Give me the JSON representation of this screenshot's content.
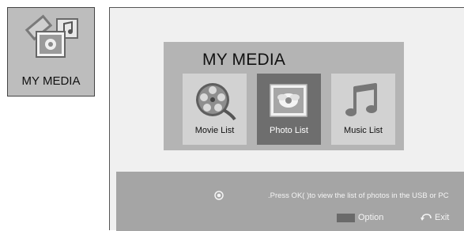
{
  "tile": {
    "label": "MY MEDIA",
    "icon": "my-media-icon"
  },
  "panel": {
    "title": "MY MEDIA",
    "items": [
      {
        "label": "Movie List",
        "icon": "film-reel-icon",
        "selected": false
      },
      {
        "label": "Photo List",
        "icon": "photo-icon",
        "selected": true
      },
      {
        "label": "Music List",
        "icon": "music-note-icon",
        "selected": false
      }
    ]
  },
  "bottom_bar": {
    "ok_icon": "ok-button-icon",
    "hint": ".Press OK(     )to view the list of photos in the USB or PC",
    "option_label": "Option",
    "exit_icon": "return-arrow-icon",
    "exit_label": "Exit"
  },
  "colors": {
    "panel": "#b4b4b4",
    "selected": "#6e6e6e",
    "bar": "#a5a5a5"
  }
}
